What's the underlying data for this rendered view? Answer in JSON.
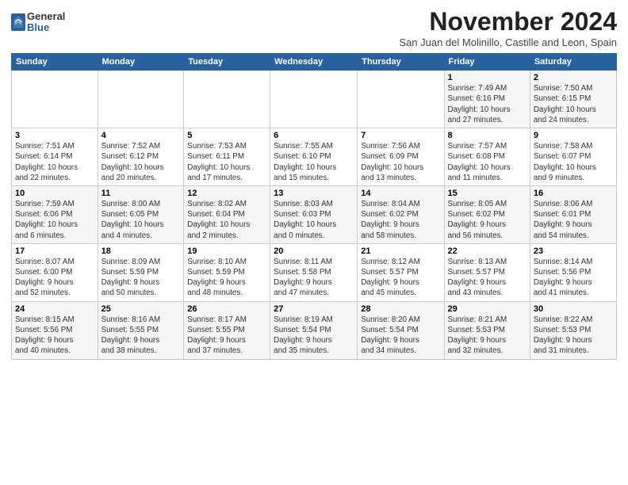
{
  "logo": {
    "general": "General",
    "blue": "Blue"
  },
  "title": "November 2024",
  "subtitle": "San Juan del Molinillo, Castille and Leon, Spain",
  "weekdays": [
    "Sunday",
    "Monday",
    "Tuesday",
    "Wednesday",
    "Thursday",
    "Friday",
    "Saturday"
  ],
  "weeks": [
    [
      {
        "day": "",
        "info": ""
      },
      {
        "day": "",
        "info": ""
      },
      {
        "day": "",
        "info": ""
      },
      {
        "day": "",
        "info": ""
      },
      {
        "day": "",
        "info": ""
      },
      {
        "day": "1",
        "info": "Sunrise: 7:49 AM\nSunset: 6:16 PM\nDaylight: 10 hours\nand 27 minutes."
      },
      {
        "day": "2",
        "info": "Sunrise: 7:50 AM\nSunset: 6:15 PM\nDaylight: 10 hours\nand 24 minutes."
      }
    ],
    [
      {
        "day": "3",
        "info": "Sunrise: 7:51 AM\nSunset: 6:14 PM\nDaylight: 10 hours\nand 22 minutes."
      },
      {
        "day": "4",
        "info": "Sunrise: 7:52 AM\nSunset: 6:12 PM\nDaylight: 10 hours\nand 20 minutes."
      },
      {
        "day": "5",
        "info": "Sunrise: 7:53 AM\nSunset: 6:11 PM\nDaylight: 10 hours\nand 17 minutes."
      },
      {
        "day": "6",
        "info": "Sunrise: 7:55 AM\nSunset: 6:10 PM\nDaylight: 10 hours\nand 15 minutes."
      },
      {
        "day": "7",
        "info": "Sunrise: 7:56 AM\nSunset: 6:09 PM\nDaylight: 10 hours\nand 13 minutes."
      },
      {
        "day": "8",
        "info": "Sunrise: 7:57 AM\nSunset: 6:08 PM\nDaylight: 10 hours\nand 11 minutes."
      },
      {
        "day": "9",
        "info": "Sunrise: 7:58 AM\nSunset: 6:07 PM\nDaylight: 10 hours\nand 9 minutes."
      }
    ],
    [
      {
        "day": "10",
        "info": "Sunrise: 7:59 AM\nSunset: 6:06 PM\nDaylight: 10 hours\nand 6 minutes."
      },
      {
        "day": "11",
        "info": "Sunrise: 8:00 AM\nSunset: 6:05 PM\nDaylight: 10 hours\nand 4 minutes."
      },
      {
        "day": "12",
        "info": "Sunrise: 8:02 AM\nSunset: 6:04 PM\nDaylight: 10 hours\nand 2 minutes."
      },
      {
        "day": "13",
        "info": "Sunrise: 8:03 AM\nSunset: 6:03 PM\nDaylight: 10 hours\nand 0 minutes."
      },
      {
        "day": "14",
        "info": "Sunrise: 8:04 AM\nSunset: 6:02 PM\nDaylight: 9 hours\nand 58 minutes."
      },
      {
        "day": "15",
        "info": "Sunrise: 8:05 AM\nSunset: 6:02 PM\nDaylight: 9 hours\nand 56 minutes."
      },
      {
        "day": "16",
        "info": "Sunrise: 8:06 AM\nSunset: 6:01 PM\nDaylight: 9 hours\nand 54 minutes."
      }
    ],
    [
      {
        "day": "17",
        "info": "Sunrise: 8:07 AM\nSunset: 6:00 PM\nDaylight: 9 hours\nand 52 minutes."
      },
      {
        "day": "18",
        "info": "Sunrise: 8:09 AM\nSunset: 5:59 PM\nDaylight: 9 hours\nand 50 minutes."
      },
      {
        "day": "19",
        "info": "Sunrise: 8:10 AM\nSunset: 5:59 PM\nDaylight: 9 hours\nand 48 minutes."
      },
      {
        "day": "20",
        "info": "Sunrise: 8:11 AM\nSunset: 5:58 PM\nDaylight: 9 hours\nand 47 minutes."
      },
      {
        "day": "21",
        "info": "Sunrise: 8:12 AM\nSunset: 5:57 PM\nDaylight: 9 hours\nand 45 minutes."
      },
      {
        "day": "22",
        "info": "Sunrise: 8:13 AM\nSunset: 5:57 PM\nDaylight: 9 hours\nand 43 minutes."
      },
      {
        "day": "23",
        "info": "Sunrise: 8:14 AM\nSunset: 5:56 PM\nDaylight: 9 hours\nand 41 minutes."
      }
    ],
    [
      {
        "day": "24",
        "info": "Sunrise: 8:15 AM\nSunset: 5:56 PM\nDaylight: 9 hours\nand 40 minutes."
      },
      {
        "day": "25",
        "info": "Sunrise: 8:16 AM\nSunset: 5:55 PM\nDaylight: 9 hours\nand 38 minutes."
      },
      {
        "day": "26",
        "info": "Sunrise: 8:17 AM\nSunset: 5:55 PM\nDaylight: 9 hours\nand 37 minutes."
      },
      {
        "day": "27",
        "info": "Sunrise: 8:19 AM\nSunset: 5:54 PM\nDaylight: 9 hours\nand 35 minutes."
      },
      {
        "day": "28",
        "info": "Sunrise: 8:20 AM\nSunset: 5:54 PM\nDaylight: 9 hours\nand 34 minutes."
      },
      {
        "day": "29",
        "info": "Sunrise: 8:21 AM\nSunset: 5:53 PM\nDaylight: 9 hours\nand 32 minutes."
      },
      {
        "day": "30",
        "info": "Sunrise: 8:22 AM\nSunset: 5:53 PM\nDaylight: 9 hours\nand 31 minutes."
      }
    ]
  ]
}
